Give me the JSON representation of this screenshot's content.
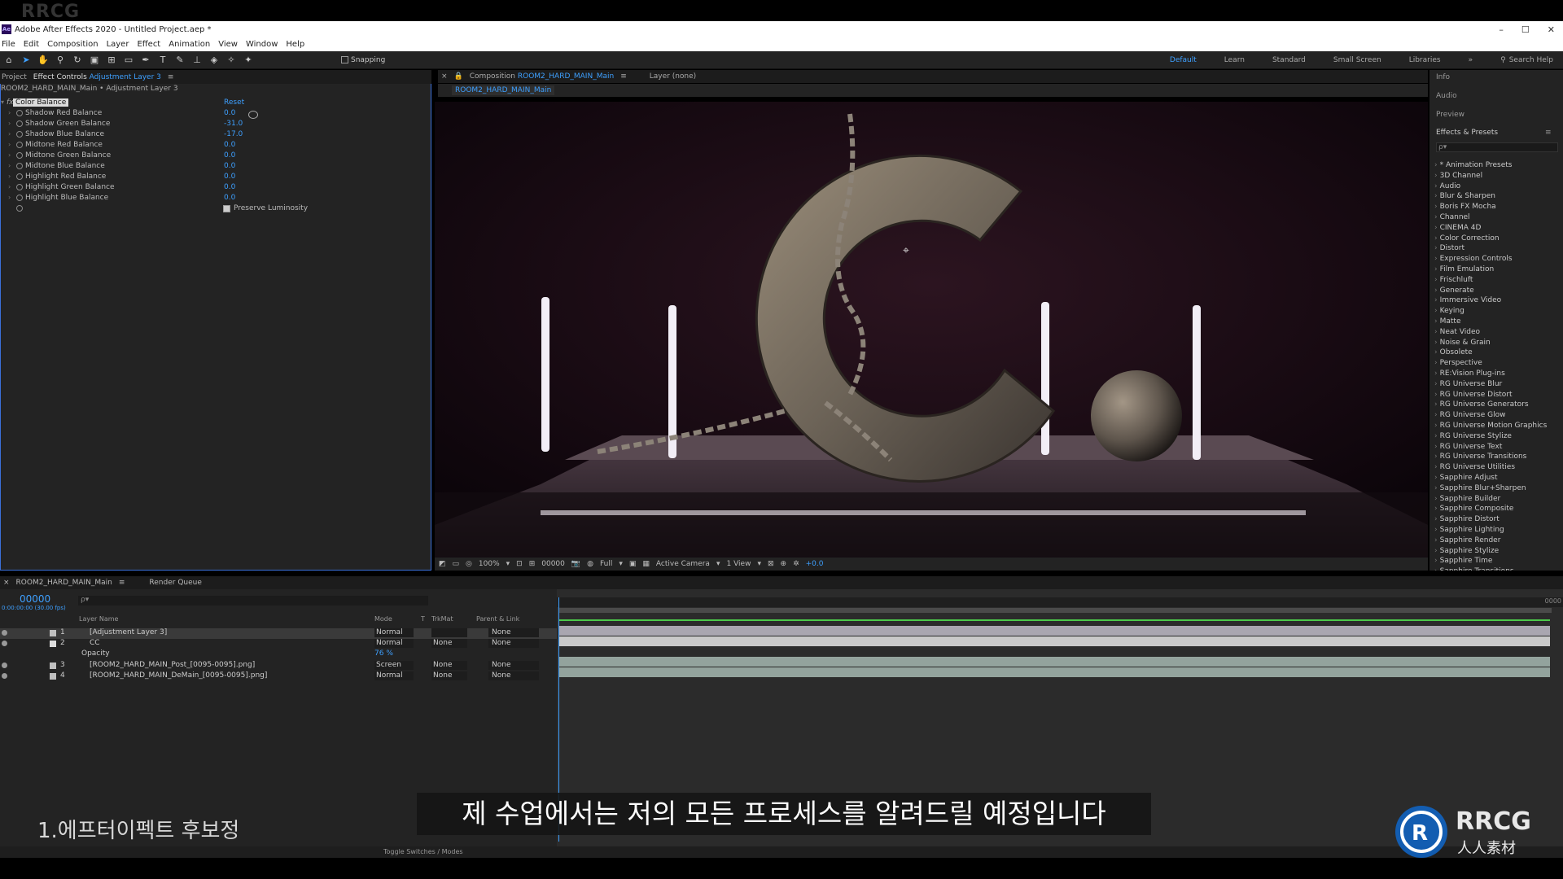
{
  "watermark": "RRCG",
  "window": {
    "title": "Adobe After Effects 2020 - Untitled Project.aep *",
    "app_icon": "Ae",
    "controls": [
      "–",
      "☐",
      "✕"
    ]
  },
  "menu": [
    "File",
    "Edit",
    "Composition",
    "Layer",
    "Effect",
    "Animation",
    "View",
    "Window",
    "Help"
  ],
  "toolbar": {
    "snapping_label": "Snapping",
    "workspaces": [
      "Default",
      "Learn",
      "Standard",
      "Small Screen",
      "Libraries"
    ],
    "search_help": "Search Help"
  },
  "left_panel": {
    "tabs": [
      "Project",
      "Effect Controls",
      "Adjustment Layer 3"
    ],
    "header": "ROOM2_HARD_MAIN_Main • Adjustment Layer 3",
    "effect": {
      "fx": "fx",
      "name": "Color Balance",
      "reset": "Reset",
      "properties": [
        {
          "name": "Shadow Red Balance",
          "value": "0.0"
        },
        {
          "name": "Shadow Green Balance",
          "value": "-31.0"
        },
        {
          "name": "Shadow Blue Balance",
          "value": "-17.0"
        },
        {
          "name": "Midtone Red Balance",
          "value": "0.0"
        },
        {
          "name": "Midtone Green Balance",
          "value": "0.0"
        },
        {
          "name": "Midtone Blue Balance",
          "value": "0.0"
        },
        {
          "name": "Highlight Red Balance",
          "value": "0.0"
        },
        {
          "name": "Highlight Green Balance",
          "value": "0.0"
        },
        {
          "name": "Highlight Blue Balance",
          "value": "0.0"
        }
      ],
      "preserve_luminosity": "Preserve Luminosity"
    }
  },
  "comp_panel": {
    "tab_prefix": "Composition",
    "tab_comp": "ROOM2_HARD_MAIN_Main",
    "layer_tab": "Layer (none)",
    "subtab": "ROOM2_HARD_MAIN_Main",
    "viewer_bar": {
      "zoom": "100%",
      "timecode": "00000",
      "resolution": "Full",
      "camera": "Active Camera",
      "views": "1 View",
      "exposure": "+0.0"
    }
  },
  "right_panel": {
    "info": "Info",
    "audio": "Audio",
    "preview": "Preview",
    "effects_presets": "Effects & Presets",
    "search_placeholder": "ρ▾",
    "items": [
      "* Animation Presets",
      "3D Channel",
      "Audio",
      "Blur & Sharpen",
      "Boris FX Mocha",
      "Channel",
      "CINEMA 4D",
      "Color Correction",
      "Distort",
      "Expression Controls",
      "Film Emulation",
      "Frischluft",
      "Generate",
      "Immersive Video",
      "Keying",
      "Matte",
      "Neat Video",
      "Noise & Grain",
      "Obsolete",
      "Perspective",
      "RE:Vision Plug-ins",
      "RG Universe Blur",
      "RG Universe Distort",
      "RG Universe Generators",
      "RG Universe Glow",
      "RG Universe Motion Graphics",
      "RG Universe Stylize",
      "RG Universe Text",
      "RG Universe Transitions",
      "RG Universe Utilities",
      "Sapphire Adjust",
      "Sapphire Blur+Sharpen",
      "Sapphire Builder",
      "Sapphire Composite",
      "Sapphire Distort",
      "Sapphire Lighting",
      "Sapphire Render",
      "Sapphire Stylize",
      "Sapphire Time",
      "Sapphire Transitions"
    ]
  },
  "timeline": {
    "tabs": [
      "ROOM2_HARD_MAIN_Main",
      "Render Queue"
    ],
    "timecode": "00000",
    "sub": "0:00:00:00 (30.00 fps)",
    "search": "ρ▾",
    "columns": {
      "name": "Layer Name",
      "mode": "Mode",
      "t": "T",
      "trkmat": "TrkMat",
      "parent": "Parent & Link"
    },
    "layers": [
      {
        "num": "1",
        "name": "[Adjustment Layer 3]",
        "mode": "Normal",
        "trkmat": "",
        "parent": "None",
        "color": "#c0c0c0"
      },
      {
        "num": "2",
        "name": "CC",
        "mode": "Normal",
        "trkmat": "None",
        "parent": "None",
        "color": "#dddddd"
      },
      {
        "num": "3",
        "name": "[ROOM2_HARD_MAIN_Post_[0095-0095].png]",
        "mode": "Screen",
        "trkmat": "None",
        "parent": "None",
        "color": "#bfbfbf"
      },
      {
        "num": "4",
        "name": "[ROOM2_HARD_MAIN_DeMain_[0095-0095].png]",
        "mode": "Normal",
        "trkmat": "None",
        "parent": "None",
        "color": "#bfbfbf"
      }
    ],
    "opacity_label": "Opacity",
    "opacity_value": "76 %",
    "ruler_start": "0",
    "ruler_end": "0000",
    "toggle": "Toggle Switches / Modes"
  },
  "subtitle": "제 수업에서는 저의 모든 프로세스를 알려드릴 예정입니다",
  "caption": "1.에프터이펙트 후보정",
  "logo": {
    "text": "RRCG",
    "sub": "人人素材"
  },
  "colors": {
    "accent": "#3ea0ff",
    "green": "#4cc94a",
    "panel": "#232323"
  }
}
